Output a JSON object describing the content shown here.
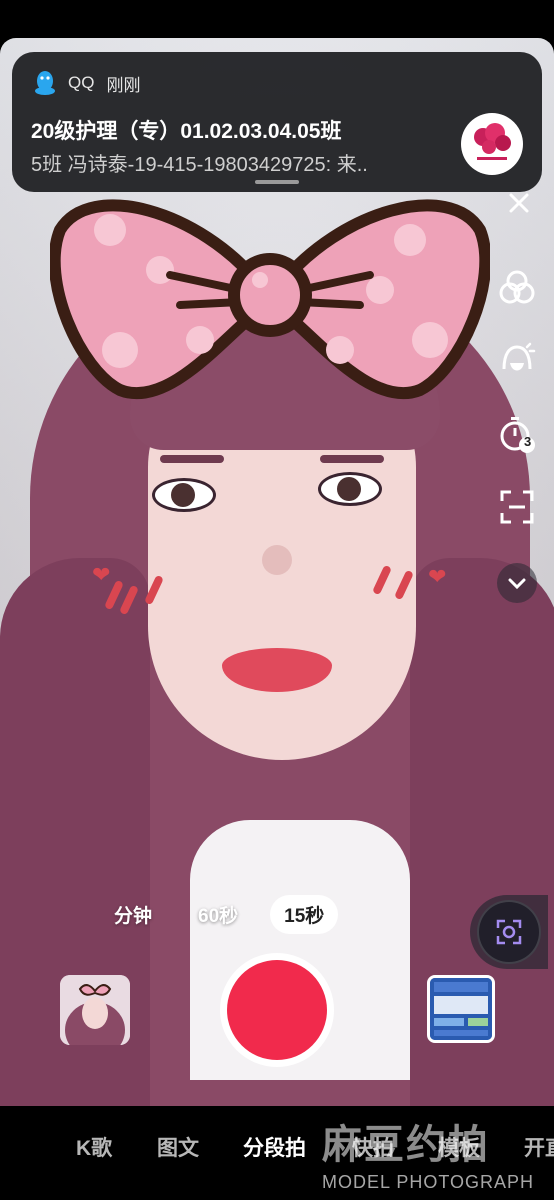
{
  "notification": {
    "app_name": "QQ",
    "time": "刚刚",
    "title": "20级护理（专）01.02.03.04.05班",
    "body": "5班 冯诗泰-19-415-19803429725: 来.."
  },
  "durations": [
    {
      "label": "分钟",
      "active": false
    },
    {
      "label": "60秒",
      "active": false
    },
    {
      "label": "15秒",
      "active": true
    }
  ],
  "side_tools": {
    "timer_badge": "3"
  },
  "modes": [
    {
      "label": "K歌",
      "active": false
    },
    {
      "label": "图文",
      "active": false
    },
    {
      "label": "分段拍",
      "active": true
    },
    {
      "label": "快拍",
      "active": false
    },
    {
      "label": "模板",
      "active": false
    },
    {
      "label": "开直",
      "active": false
    }
  ],
  "watermark": {
    "brand": "麻豆约拍",
    "sub": "MODEL PHOTOGRAPH"
  },
  "colors": {
    "record": "#f12a4c",
    "hair": "#8a4a66",
    "bow_pink": "#eea2b8"
  }
}
